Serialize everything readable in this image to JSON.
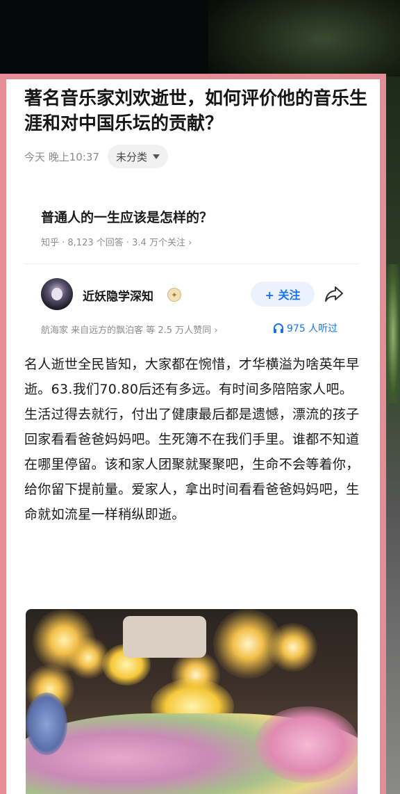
{
  "question": {
    "title": "著名音乐家刘欢逝世，如何评价他的音乐生涯和对中国乐坛的贡献？",
    "time": "今天 晚上10:37",
    "category": "未分类"
  },
  "related_question": {
    "title": "普通人的一生应该是怎样的？",
    "meta": "知乎 · 8,123 个回答 · 3.4 万个关注 ›"
  },
  "author": {
    "name": "近妖隐学深知",
    "follow_label": "+ 关注",
    "stats": "航海家 来自远方的飘泊客 等 2.5 万人赞同 ›",
    "listen": "975 人听过"
  },
  "answer": {
    "text": "名人逝世全民皆知，大家都在惋惜，才华横溢为啥英年早逝。63.我们70.80后还有多远。有时间多陪陪家人吧。生活过得去就行，付出了健康最后都是遗憾，漂流的孩子回家看看爸爸妈妈吧。生死簿不在我们手里。谁都不知道在哪里停留。该和家人团聚就聚聚吧，生命不会等着你，给你留下提前量。爱家人，拿出时间看看爸爸妈妈吧，生命就如流星一样稍纵即逝。"
  },
  "icons": {
    "dropdown": "chevron-down-icon",
    "share": "share-icon",
    "headphones": "headphones-icon",
    "badge": "badge-icon"
  },
  "colors": {
    "frame": "#e58d97",
    "accent": "#1772f6"
  }
}
